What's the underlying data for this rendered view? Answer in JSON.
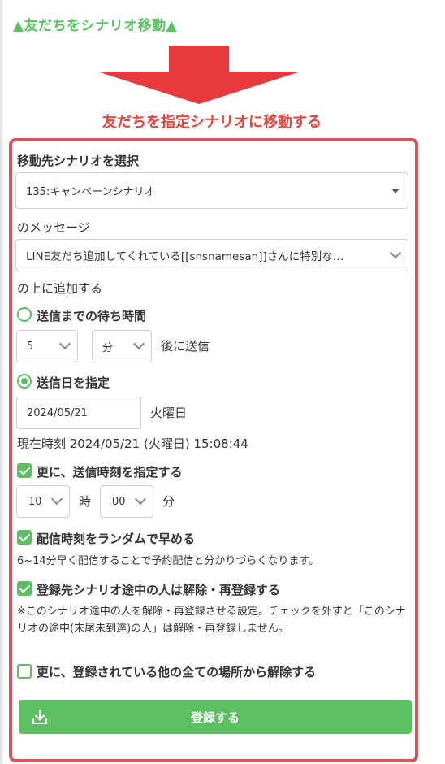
{
  "header": {
    "title": "▲友だちをシナリオ移動▲"
  },
  "subtitle": "友だちを指定シナリオに移動する",
  "form": {
    "scenario_label": "移動先シナリオを選択",
    "scenario_value": "135:キャンペーンシナリオ",
    "message_label": "のメッセージ",
    "message_value": "LINE友だち追加してくれている[[snsnamesan]]さんに特別な…",
    "add_above_label": "の上に追加する",
    "wait_option_label": "送信までの待ち時間",
    "wait_amount": "5",
    "wait_unit": "分",
    "wait_suffix": "後に送信",
    "date_option_label": "送信日を指定",
    "date_value": "2024/05/21",
    "weekday": "火曜日",
    "current_time": "現在時刻 2024/05/21 (火曜日) 15:08:44",
    "time_checkbox_label": "更に、送信時刻を指定する",
    "hour_value": "10",
    "hour_suffix": "時",
    "minute_value": "00",
    "minute_suffix": "分",
    "random_checkbox_label": "配信時刻をランダムで早める",
    "random_note": "6~14分早く配信することで予約配信と分かりづらくなります。",
    "reregister_checkbox_label": "登録先シナリオ途中の人は解除・再登録する",
    "reregister_note": "※このシナリオ途中の人を解除・再登録させる設定。チェックを外すと「このシナリオの途中(末尾未到達)の人」は解除・再登録しません。",
    "unregister_checkbox_label": "更に、登録されている他の全ての場所から解除する",
    "submit_label": "登録する"
  },
  "state": {
    "wait_selected": false,
    "date_selected": true,
    "time_checked": true,
    "random_checked": true,
    "reregister_checked": true,
    "unregister_checked": false
  },
  "colors": {
    "accent_green": "#5cc063",
    "accent_red": "#e0473f",
    "border_red": "#d9545a"
  },
  "icons": {
    "submit": "download-icon"
  }
}
